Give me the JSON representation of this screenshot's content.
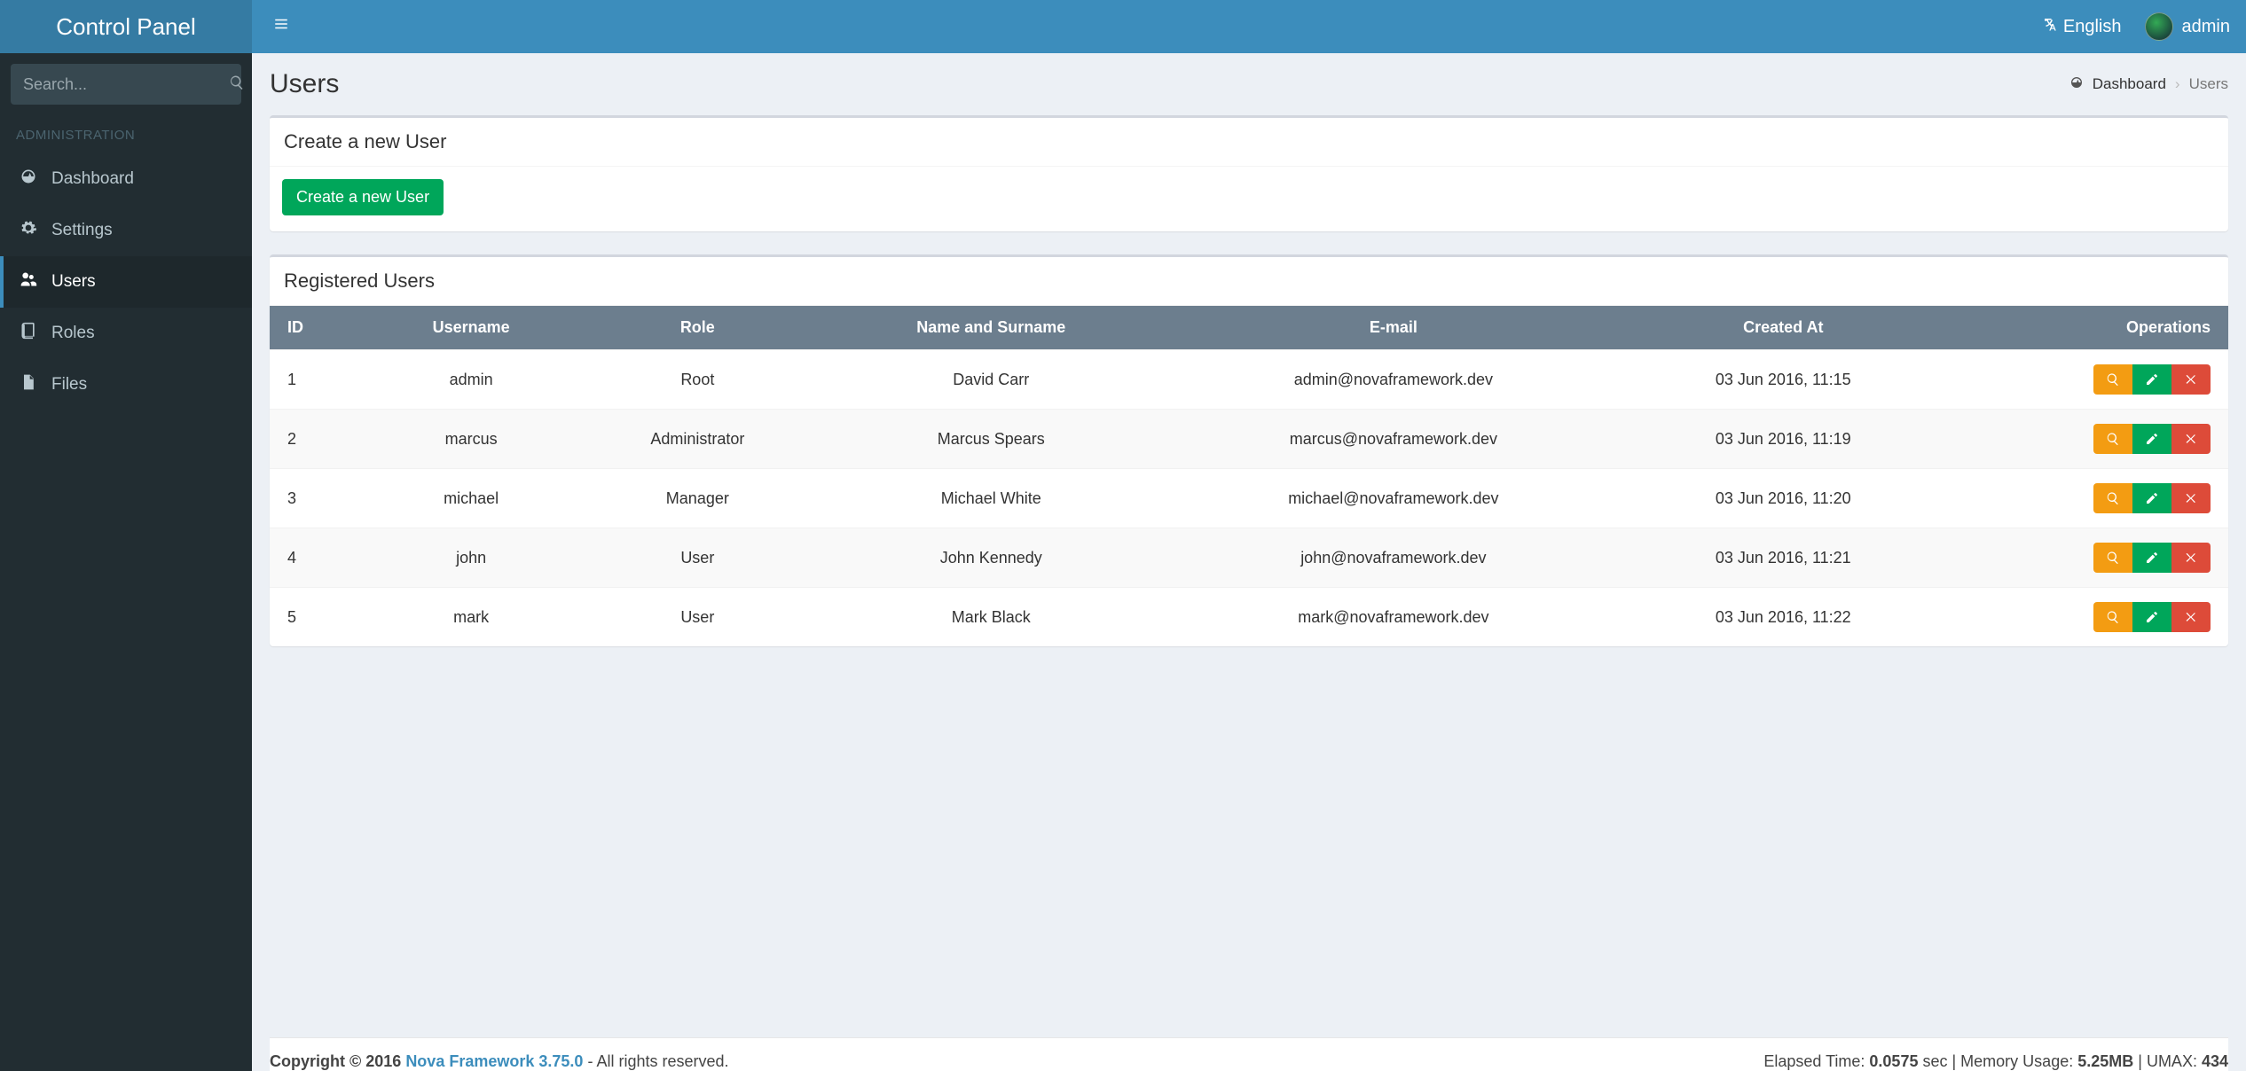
{
  "brand": "Control Panel",
  "header": {
    "language_label": "English",
    "username": "admin"
  },
  "sidebar": {
    "search_placeholder": "Search...",
    "section_label": "ADMINISTRATION",
    "items": [
      {
        "label": "Dashboard"
      },
      {
        "label": "Settings"
      },
      {
        "label": "Users"
      },
      {
        "label": "Roles"
      },
      {
        "label": "Files"
      }
    ]
  },
  "page": {
    "title": "Users",
    "breadcrumb_root": "Dashboard",
    "breadcrumb_current": "Users"
  },
  "create_panel": {
    "title": "Create a new User",
    "button": "Create a new User"
  },
  "users_panel": {
    "title": "Registered Users",
    "columns": {
      "id": "ID",
      "username": "Username",
      "role": "Role",
      "name": "Name and Surname",
      "email": "E-mail",
      "created": "Created At",
      "ops": "Operations"
    },
    "rows": [
      {
        "id": "1",
        "username": "admin",
        "role": "Root",
        "name": "David Carr",
        "email": "admin@novaframework.dev",
        "created": "03 Jun 2016, 11:15"
      },
      {
        "id": "2",
        "username": "marcus",
        "role": "Administrator",
        "name": "Marcus Spears",
        "email": "marcus@novaframework.dev",
        "created": "03 Jun 2016, 11:19"
      },
      {
        "id": "3",
        "username": "michael",
        "role": "Manager",
        "name": "Michael White",
        "email": "michael@novaframework.dev",
        "created": "03 Jun 2016, 11:20"
      },
      {
        "id": "4",
        "username": "john",
        "role": "User",
        "name": "John Kennedy",
        "email": "john@novaframework.dev",
        "created": "03 Jun 2016, 11:21"
      },
      {
        "id": "5",
        "username": "mark",
        "role": "User",
        "name": "Mark Black",
        "email": "mark@novaframework.dev",
        "created": "03 Jun 2016, 11:22"
      }
    ]
  },
  "footer": {
    "copyright_prefix": "Copyright © 2016 ",
    "framework": "Nova Framework 3.75.0",
    "rights": " - All rights reserved.",
    "stats_time_label": "Elapsed Time: ",
    "stats_time_value": "0.0575",
    "stats_time_unit": " sec | Memory Usage: ",
    "stats_mem_value": "5.25MB",
    "stats_umax_label": " | UMAX: ",
    "stats_umax_value": "434"
  }
}
